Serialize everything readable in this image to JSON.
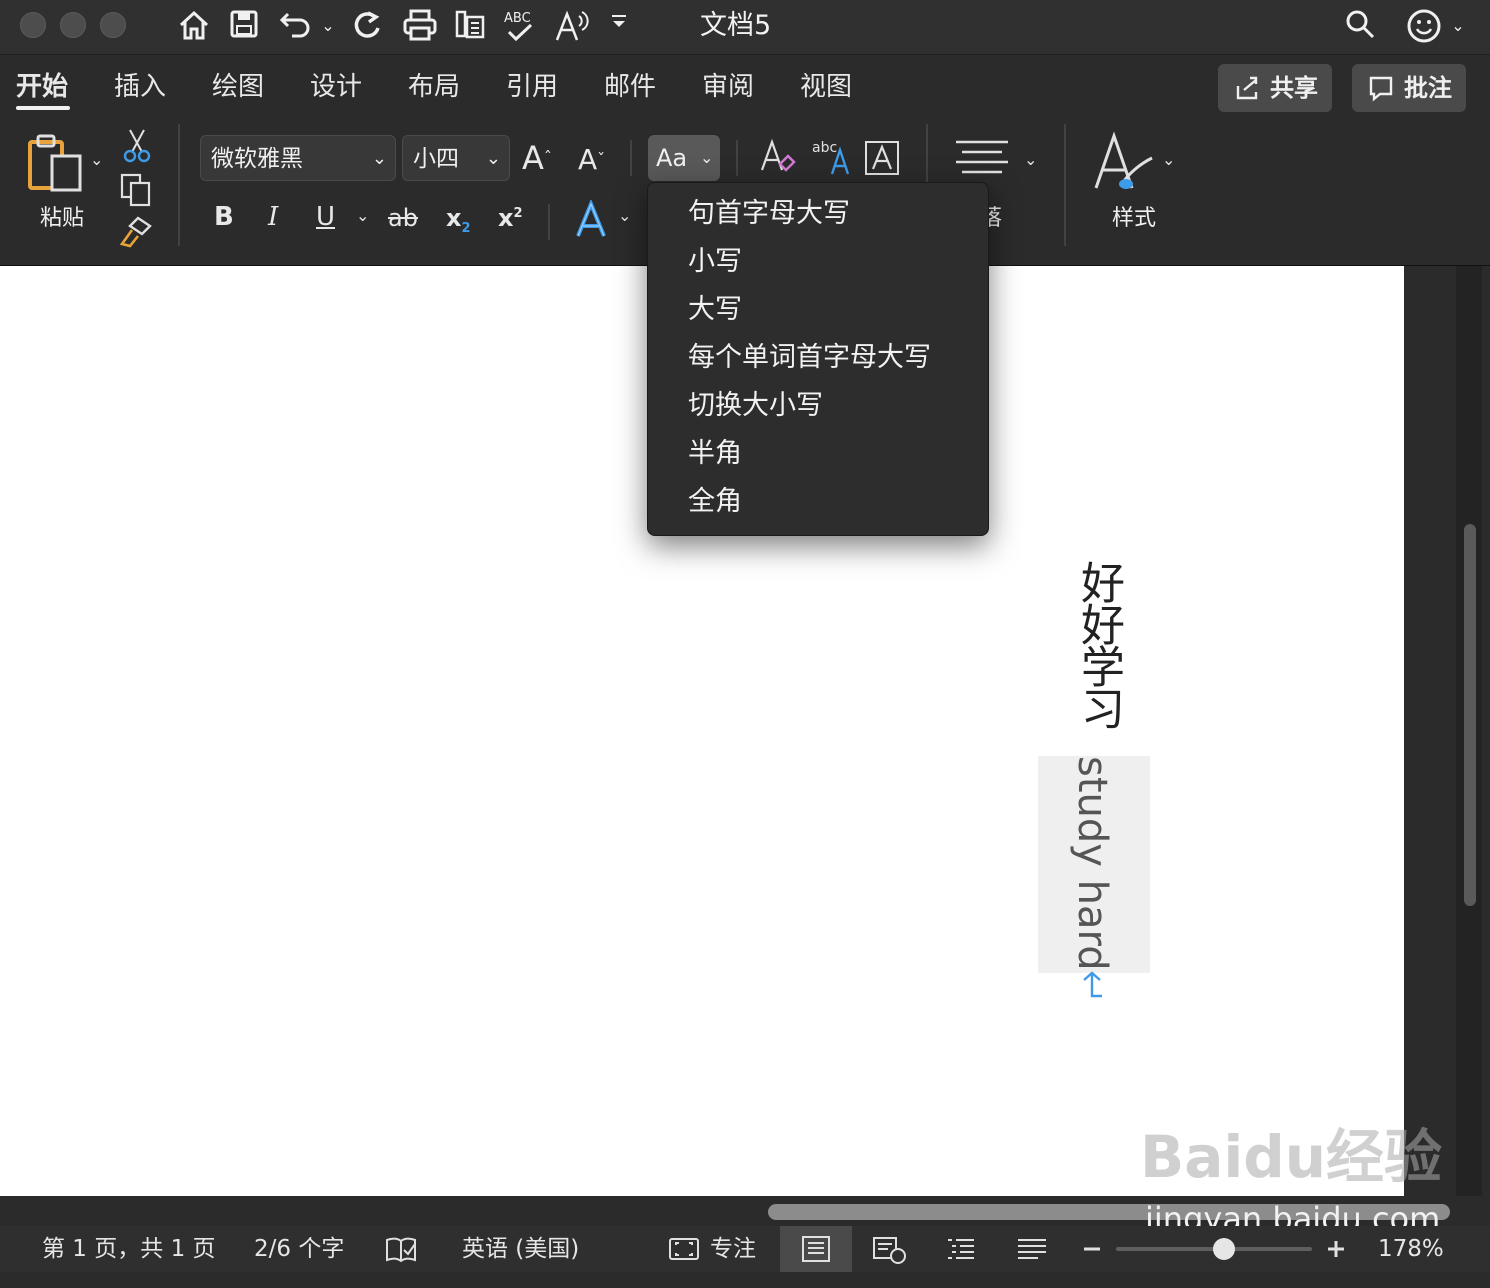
{
  "window": {
    "title": "文档5"
  },
  "tabs": [
    {
      "label": "开始",
      "active": true
    },
    {
      "label": "插入"
    },
    {
      "label": "绘图"
    },
    {
      "label": "设计"
    },
    {
      "label": "布局"
    },
    {
      "label": "引用"
    },
    {
      "label": "邮件"
    },
    {
      "label": "审阅"
    },
    {
      "label": "视图"
    }
  ],
  "header_buttons": {
    "share_label": "共享",
    "comments_label": "批注"
  },
  "ribbon": {
    "paste_label": "粘贴",
    "font_name": "微软雅黑",
    "font_size": "小四",
    "change_case_label": "Aa",
    "paragraph_label": "段落",
    "styles_label": "样式",
    "bold": "B",
    "italic": "I",
    "underline": "U",
    "strike": "ab",
    "subscript": "x",
    "superscript": "x",
    "grow": "A",
    "shrink": "A"
  },
  "case_menu": {
    "items": [
      "句首字母大写",
      "小写",
      "大写",
      "每个单词首字母大写",
      "切换大小写",
      "半角",
      "全角"
    ]
  },
  "document": {
    "vertical_chinese": "好好学习",
    "vertical_english": "study hard"
  },
  "status_bar": {
    "page": "第 1 页，共 1 页",
    "words": "2/6 个字",
    "language": "英语 (美国)",
    "focus": "专注",
    "zoom": "178%",
    "zoom_level": 0.55
  },
  "watermark": {
    "text1": "Baidu经验",
    "text2": "jingyan.baidu.com"
  }
}
